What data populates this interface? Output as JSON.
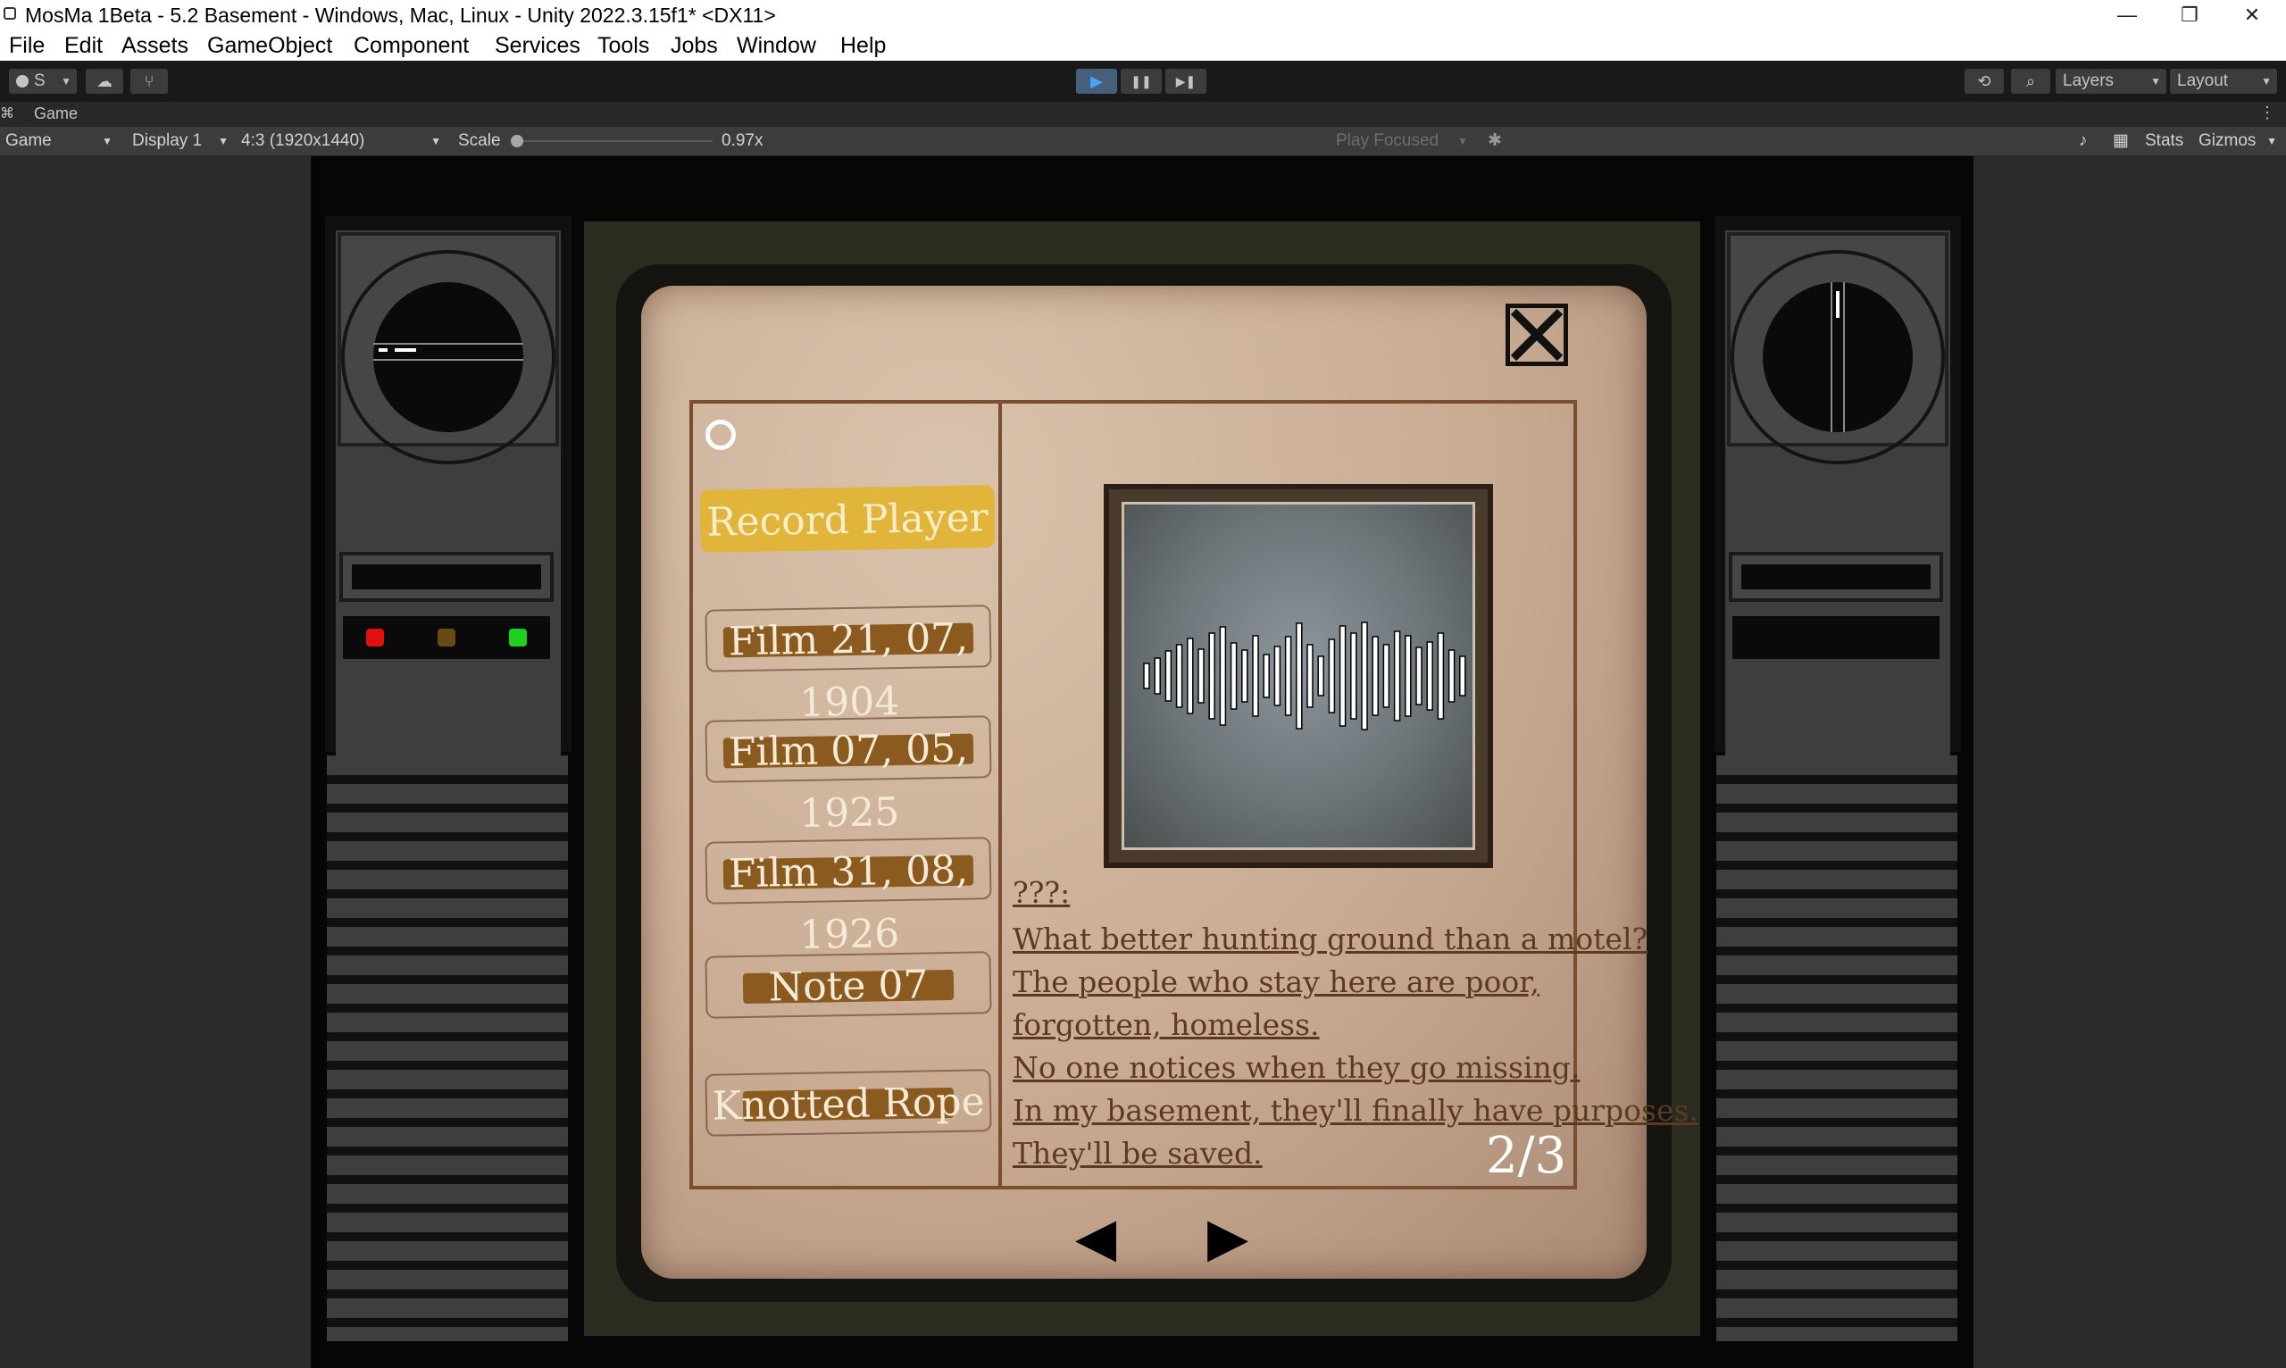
{
  "window": {
    "title": "MosMa 1Beta - 5.2 Basement - Windows, Mac, Linux - Unity 2022.3.15f1* <DX11>",
    "controls": {
      "minimize": "—",
      "maximize": "❐",
      "close": "✕"
    }
  },
  "menu": [
    "File",
    "Edit",
    "Assets",
    "GameObject",
    "Component",
    "Services",
    "Tools",
    "Jobs",
    "Window",
    "Help"
  ],
  "toolbar": {
    "account_label": "S",
    "play_icon": "▶",
    "pause_icon": "❚❚",
    "step_icon": "▶❚",
    "layers_label": "Layers",
    "layout_label": "Layout"
  },
  "game_tab": {
    "label": "Game"
  },
  "game_bar": {
    "view_dropdown": "Game",
    "display_dropdown": "Display 1",
    "aspect_dropdown": "4:3 (1920x1440)",
    "scale_label": "Scale",
    "scale_value": "0.97x",
    "scale_level": 0.0,
    "play_focused": "Play Focused",
    "stats_label": "Stats",
    "gizmos_label": "Gizmos"
  },
  "journal": {
    "close_icon": "close-x-icon",
    "items": [
      "Record Player",
      "Film 21, 07, 1904",
      "Film 07, 05, 1925",
      "Film 31, 08, 1926",
      "Note 07",
      "Knotted Rope"
    ],
    "selected_index": 0,
    "speaker": "???:",
    "lines": [
      "What better hunting ground than a motel?",
      "The people who stay here are poor,",
      "forgotten, homeless.",
      "No one notices when they go missing.",
      "In my basement, they'll finally have purposes.",
      "They'll be saved."
    ],
    "page_indicator": "2/3",
    "prev_icon": "◀",
    "next_icon": "▶"
  },
  "colors": {
    "selected_highlight": "#e1b53a",
    "item_band": "#8a5a1f",
    "led_red": "#e01010",
    "led_amber": "#6a4a10",
    "led_green": "#20d020",
    "editor_bg": "#1e1e1e"
  }
}
